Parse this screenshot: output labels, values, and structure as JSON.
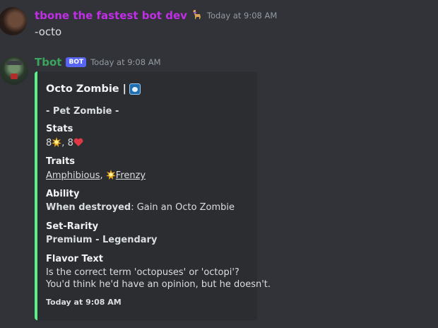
{
  "message1": {
    "username": "tbone the fastest bot dev",
    "timestamp": "Today at 9:08 AM",
    "content": "-octo",
    "badge_icon": "llama-icon"
  },
  "message2": {
    "username": "Tbot",
    "badge": "BOT",
    "timestamp": "Today at 9:08 AM"
  },
  "embed": {
    "accent_color": "#57f287",
    "title": "Octo Zombie |",
    "title_icon": "paw-icon",
    "subtitle": "- Pet Zombie -",
    "fields": {
      "stats": {
        "name": "Stats",
        "strength": "8",
        "separator": ",",
        "health": "8"
      },
      "traits": {
        "name": "Traits",
        "trait1": "Amphibious",
        "separator": ",",
        "trait2": "Frenzy"
      },
      "ability": {
        "name": "Ability",
        "trigger": "When destroyed",
        "text": ": Gain an Octo Zombie"
      },
      "set_rarity": {
        "name": "Set-Rarity",
        "value": "Premium - Legendary"
      },
      "flavor": {
        "name": "Flavor Text",
        "line1": "Is the correct term 'octopuses' or 'octopi'?",
        "line2": "You'd think he'd have an opinion, but he doesn't."
      }
    },
    "footer": "Today at 9:08 AM"
  }
}
